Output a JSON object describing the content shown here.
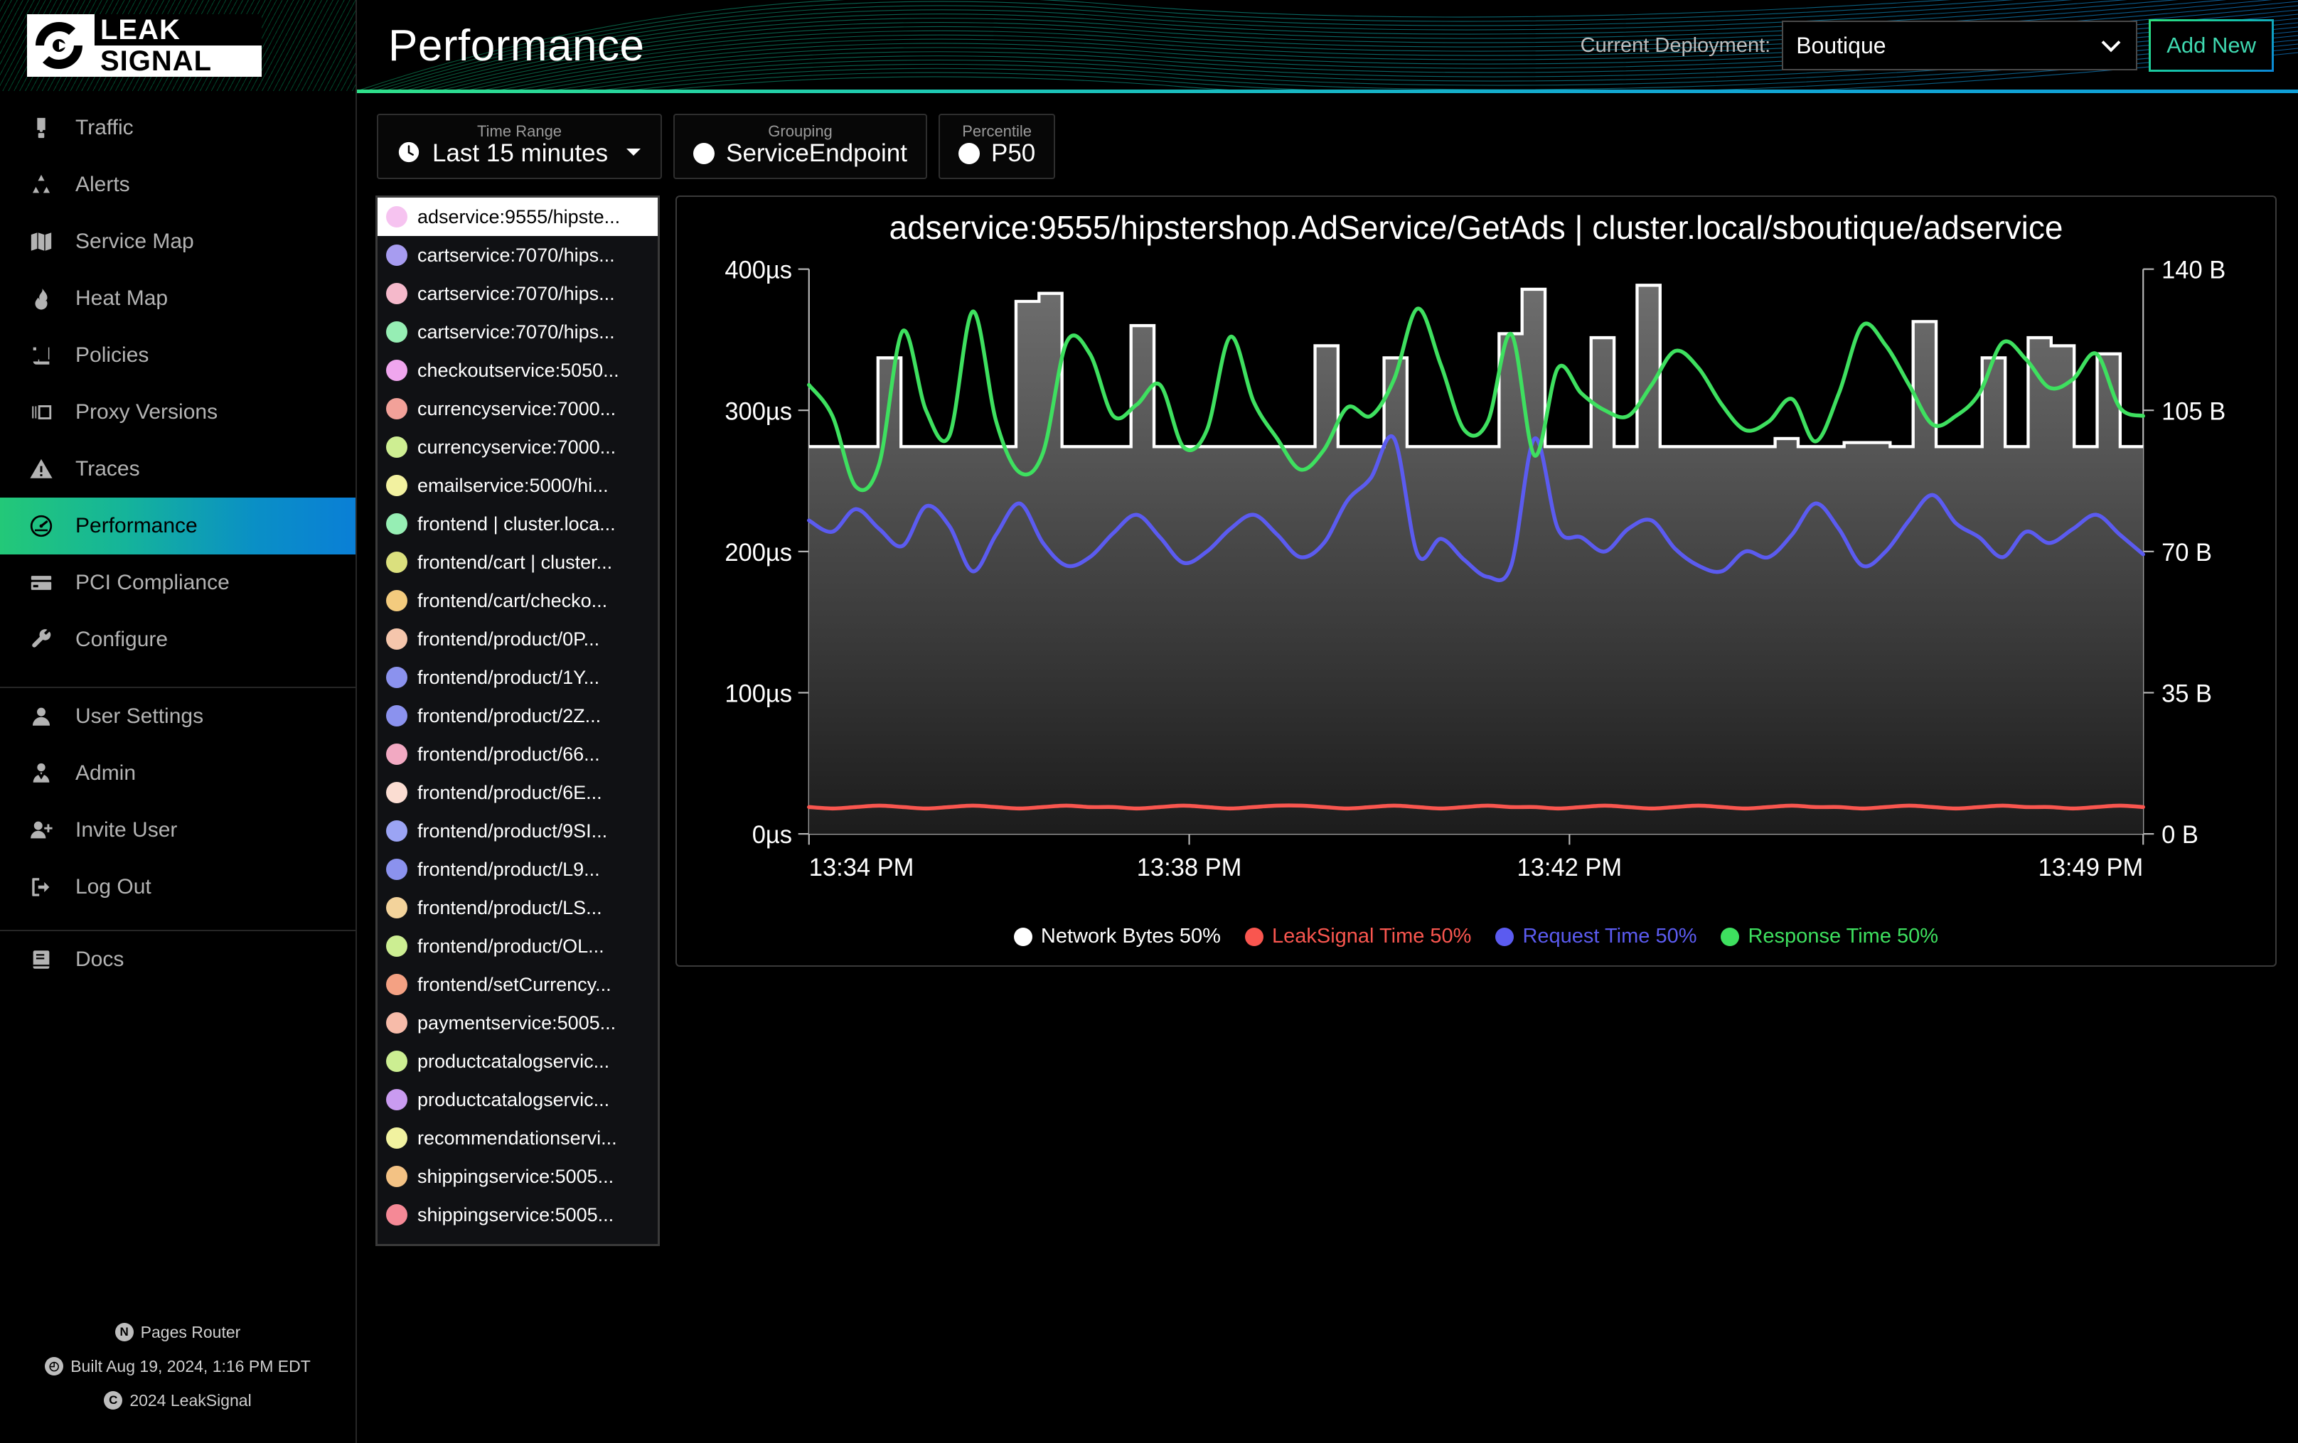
{
  "brand": {
    "line1": "LEAK",
    "line2": "SIGNAL",
    "logo_icon": "leaksignal-target-icon"
  },
  "header": {
    "title": "Performance",
    "deployment_label": "Current Deployment:",
    "deployment_value": "Boutique",
    "add_new_label": "Add New",
    "accent_gradient": [
      "#2fe08a",
      "#0f9fd8"
    ]
  },
  "sidebar": {
    "primary_items": [
      {
        "label": "Traffic",
        "icon": "traffic-light-icon",
        "active": false
      },
      {
        "label": "Alerts",
        "icon": "radiation-alert-icon",
        "active": false
      },
      {
        "label": "Service Map",
        "icon": "map-icon",
        "active": false
      },
      {
        "label": "Heat Map",
        "icon": "flame-icon",
        "active": false
      },
      {
        "label": "Policies",
        "icon": "scroll-icon",
        "active": false
      },
      {
        "label": "Proxy Versions",
        "icon": "proxy-brackets-icon",
        "active": false
      },
      {
        "label": "Traces",
        "icon": "warning-triangle-icon",
        "active": false
      },
      {
        "label": "Performance",
        "icon": "gauge-icon",
        "active": true
      },
      {
        "label": "PCI Compliance",
        "icon": "credit-card-icon",
        "active": false
      },
      {
        "label": "Configure",
        "icon": "wrench-icon",
        "active": false
      }
    ],
    "account_items": [
      {
        "label": "User Settings",
        "icon": "user-icon"
      },
      {
        "label": "Admin",
        "icon": "user-tie-icon"
      },
      {
        "label": "Invite User",
        "icon": "user-plus-icon"
      },
      {
        "label": "Log Out",
        "icon": "logout-icon"
      }
    ],
    "docs_items": [
      {
        "label": "Docs",
        "icon": "book-icon"
      }
    ],
    "footer": {
      "router": "Pages Router",
      "router_icon": "nextjs-icon",
      "build": "Built Aug 19, 2024, 1:16 PM EDT",
      "build_icon": "clock-icon",
      "copyright": "2024 LeakSignal",
      "copyright_icon": "copyright-icon"
    }
  },
  "filters": [
    {
      "label": "Time Range",
      "value": "Last 15 minutes",
      "icon": "clock-icon",
      "has_caret": true
    },
    {
      "label": "Grouping",
      "value": "ServiceEndpoint",
      "icon": "dot-icon",
      "has_caret": false
    },
    {
      "label": "Percentile",
      "value": "P50",
      "icon": "dot-icon",
      "has_caret": false
    }
  ],
  "service_list": [
    {
      "label": "adservice:9555/hipste...",
      "color": "#f6c3f0",
      "selected": true
    },
    {
      "label": "cartservice:7070/hips...",
      "color": "#a79cf0",
      "selected": false
    },
    {
      "label": "cartservice:7070/hips...",
      "color": "#f5b9cb",
      "selected": false
    },
    {
      "label": "cartservice:7070/hips...",
      "color": "#96eeb4",
      "selected": false
    },
    {
      "label": "checkoutservice:5050...",
      "color": "#f0a6ee",
      "selected": false
    },
    {
      "label": "currencyservice:7000...",
      "color": "#f2a199",
      "selected": false
    },
    {
      "label": "currencyservice:7000...",
      "color": "#ceee92",
      "selected": false
    },
    {
      "label": "emailservice:5000/hi...",
      "color": "#f2f1a0",
      "selected": false
    },
    {
      "label": "frontend | cluster.loca...",
      "color": "#96eeb4",
      "selected": false
    },
    {
      "label": "frontend/cart | cluster...",
      "color": "#dbe07e",
      "selected": false
    },
    {
      "label": "frontend/cart/checko...",
      "color": "#f3cb7e",
      "selected": false
    },
    {
      "label": "frontend/product/0P...",
      "color": "#f5c6ac",
      "selected": false
    },
    {
      "label": "frontend/product/1Y...",
      "color": "#8b92ee",
      "selected": false
    },
    {
      "label": "frontend/product/2Z...",
      "color": "#8b92ee",
      "selected": false
    },
    {
      "label": "frontend/product/66...",
      "color": "#f2a9c2",
      "selected": false
    },
    {
      "label": "frontend/product/6E...",
      "color": "#fbddd2",
      "selected": false
    },
    {
      "label": "frontend/product/9SI...",
      "color": "#9ba4f4",
      "selected": false
    },
    {
      "label": "frontend/product/L9...",
      "color": "#8b92ee",
      "selected": false
    },
    {
      "label": "frontend/product/LS...",
      "color": "#f3d39b",
      "selected": false
    },
    {
      "label": "frontend/product/OL...",
      "color": "#ccee92",
      "selected": false
    },
    {
      "label": "frontend/setCurrency...",
      "color": "#f4a183",
      "selected": false
    },
    {
      "label": "paymentservice:5005...",
      "color": "#f7bba9",
      "selected": false
    },
    {
      "label": "productcatalogservic...",
      "color": "#ccee92",
      "selected": false
    },
    {
      "label": "productcatalogservic...",
      "color": "#c99bf0",
      "selected": false
    },
    {
      "label": "recommendationservi...",
      "color": "#f1f2a0",
      "selected": false
    },
    {
      "label": "shippingservice:5005...",
      "color": "#f3c284",
      "selected": false
    },
    {
      "label": "shippingservice:5005...",
      "color": "#f58996",
      "selected": false
    }
  ],
  "chart_data": {
    "type": "line",
    "title": "adservice:9555/hipstershop.AdService/GetAds | cluster.local/sboutique/adservice",
    "xlabel": "",
    "ylabel": "",
    "grid": false,
    "legend_position": "bottom",
    "x_ticks": [
      "13:34 PM",
      "13:38 PM",
      "13:42 PM",
      "13:49 PM"
    ],
    "x_tick_positions": [
      0,
      0.285,
      0.57,
      1.0
    ],
    "left_axis": {
      "ticks": [
        "0µs",
        "100µs",
        "200µs",
        "300µs",
        "400µs"
      ],
      "min": 0,
      "max": 400,
      "unit": "µs"
    },
    "right_axis": {
      "ticks": [
        "0 B",
        "35 B",
        "70 B",
        "105 B",
        "140 B"
      ],
      "min": 0,
      "max": 140,
      "unit": "B"
    },
    "series": [
      {
        "name": "Network Bytes 50%",
        "color": "#ffffff",
        "fill": "#5a5a5a",
        "axis": "right",
        "style": "step-area",
        "values": [
          96,
          96,
          96,
          118,
          96,
          96,
          96,
          96,
          96,
          132,
          134,
          96,
          96,
          96,
          126,
          96,
          96,
          96,
          96,
          96,
          96,
          96,
          121,
          96,
          96,
          118,
          96,
          96,
          96,
          96,
          124,
          135,
          96,
          96,
          123,
          96,
          136,
          96,
          96,
          96,
          96,
          96,
          98,
          96,
          96,
          97,
          97,
          96,
          127,
          96,
          96,
          118,
          96,
          123,
          121,
          96,
          119,
          96
        ]
      },
      {
        "name": "LeakSignal Time 50%",
        "color": "#f9564f",
        "axis": "left",
        "style": "line",
        "values": [
          19,
          18,
          19,
          20,
          19,
          18,
          19,
          20,
          19,
          18,
          19,
          20,
          19,
          19,
          18,
          19,
          20,
          19,
          18,
          19,
          20,
          20,
          19,
          18,
          19,
          20,
          19,
          18,
          19,
          20,
          19,
          19,
          18,
          19,
          20,
          19,
          18,
          19,
          20,
          19,
          18,
          19,
          20,
          19,
          19,
          18,
          19,
          20,
          19,
          18,
          19,
          20,
          19,
          19,
          18,
          19,
          20,
          19
        ]
      },
      {
        "name": "Request Time 50%",
        "color": "#5b5bf0",
        "axis": "left",
        "style": "line",
        "values": [
          222,
          214,
          230,
          216,
          204,
          232,
          218,
          186,
          212,
          234,
          206,
          190,
          196,
          213,
          226,
          210,
          192,
          200,
          216,
          226,
          212,
          196,
          206,
          236,
          252,
          280,
          198,
          209,
          194,
          182,
          190,
          280,
          216,
          210,
          200,
          216,
          222,
          202,
          190,
          186,
          200,
          196,
          212,
          234,
          216,
          190,
          200,
          222,
          240,
          220,
          210,
          196,
          214,
          206,
          216,
          226,
          212,
          198
        ]
      },
      {
        "name": "Response Time 50%",
        "color": "#3ee05f",
        "axis": "left",
        "style": "line",
        "values": [
          318,
          296,
          246,
          262,
          356,
          300,
          282,
          370,
          292,
          256,
          270,
          348,
          340,
          296,
          304,
          318,
          274,
          286,
          352,
          306,
          280,
          258,
          272,
          302,
          296,
          322,
          372,
          332,
          286,
          292,
          354,
          268,
          330,
          312,
          300,
          296,
          318,
          342,
          330,
          304,
          286,
          292,
          308,
          278,
          312,
          360,
          346,
          318,
          290,
          296,
          312,
          348,
          336,
          316,
          322,
          340,
          302,
          296
        ]
      }
    ]
  }
}
